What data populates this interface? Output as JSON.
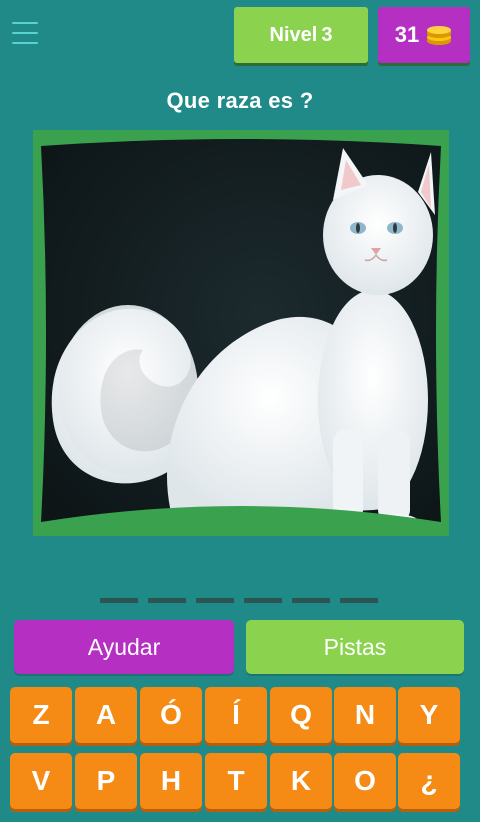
{
  "header": {
    "menu_icon": "hamburger-menu-icon",
    "level_label": "Nivel",
    "level_number": "3",
    "coins": "31",
    "coins_icon": "coin-stack-icon"
  },
  "question": "Que raza es ?",
  "answer_slots": 6,
  "actions": {
    "help_label": "Ayudar",
    "hints_label": "Pistas"
  },
  "keyboard": {
    "row1": [
      "Z",
      "A",
      "Ó",
      "Í",
      "Q",
      "N",
      "Y"
    ],
    "row2": [
      "V",
      "P",
      "H",
      "T",
      "K",
      "O",
      "¿"
    ]
  },
  "colors": {
    "background": "#1f8a87",
    "green": "#8bd34f",
    "purple": "#b52fc2",
    "orange": "#f58a14"
  }
}
